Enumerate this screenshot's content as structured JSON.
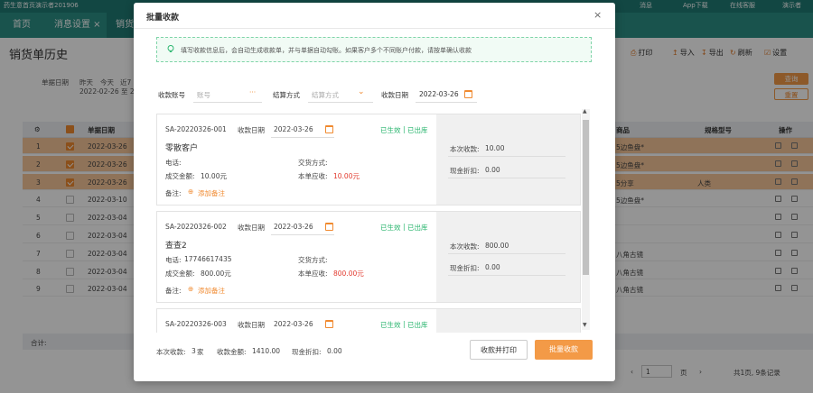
{
  "app": {
    "header_left": "药生意首页演示者201906",
    "header_right": [
      "消息",
      "App下载",
      "在线客服",
      "演示者"
    ]
  },
  "tabs": [
    {
      "label": "首页",
      "active": false
    },
    {
      "label": "消息设置 ×",
      "active": false
    },
    {
      "label": "销货",
      "active": true
    }
  ],
  "page": {
    "title": "销货单历史",
    "tools": [
      "打印",
      "导入",
      "导出",
      "刷新",
      "设置"
    ],
    "filter": {
      "label": "单据日期",
      "quick": [
        "昨天",
        "今天",
        "近7"
      ],
      "range": "2022-02-26 至 2"
    },
    "query_btn": "查询",
    "reset_btn": "重置"
  },
  "table": {
    "headers": {
      "date": "单据日期",
      "product": "商品",
      "spec": "规格型号",
      "ops": "操作"
    },
    "rows": [
      {
        "no": "1",
        "date": "2022-03-26",
        "checked": true,
        "product": "5边鱼盘*",
        "spec": ""
      },
      {
        "no": "2",
        "date": "2022-03-26",
        "checked": true,
        "product": "5边鱼盘*",
        "spec": ""
      },
      {
        "no": "3",
        "date": "2022-03-26",
        "checked": true,
        "product": "5分享",
        "spec": "人类"
      },
      {
        "no": "4",
        "date": "2022-03-10",
        "checked": false,
        "product": "5边鱼盘*",
        "spec": ""
      },
      {
        "no": "5",
        "date": "2022-03-04",
        "checked": false,
        "product": "",
        "spec": ""
      },
      {
        "no": "6",
        "date": "2022-03-04",
        "checked": false,
        "product": "",
        "spec": ""
      },
      {
        "no": "7",
        "date": "2022-03-04",
        "checked": false,
        "product": "八角古镜",
        "spec": ""
      },
      {
        "no": "8",
        "date": "2022-03-04",
        "checked": false,
        "product": "八角古镜",
        "spec": ""
      },
      {
        "no": "9",
        "date": "2022-03-04",
        "checked": false,
        "product": "八角古镜",
        "spec": ""
      }
    ],
    "sum_label": "合计:"
  },
  "pager": {
    "page": "1",
    "page_label": "页",
    "total": "共1页, 9条记录"
  },
  "modal": {
    "title": "批量收款",
    "close": "×",
    "tip": "填写收款信息后，会自动生成收款单，并与单据自动勾账。如果客户多个不同账户付款，请按单确认收款",
    "form": {
      "account_label": "收款账号",
      "account_placeholder": "账号",
      "method_label": "结算方式",
      "method_placeholder": "结算方式",
      "date_label": "收款日期",
      "date_value": "2022-03-26"
    },
    "cards": [
      {
        "no": "SA-20220326-001",
        "date_label": "收款日期",
        "date": "2022-03-26",
        "status1": "已生效",
        "status2": "已出库",
        "customer": "零散客户",
        "phone_label": "电话:",
        "phone": "",
        "delivery_label": "交货方式:",
        "delivery": "",
        "amount_label": "成交金额:",
        "amount": "10.00元",
        "receivable_label": "本单应收:",
        "receivable": "10.00元",
        "remark_label": "备注:",
        "add_remark": "添加备注",
        "this_label": "本次收款:",
        "this_value": "10.00",
        "discount_label": "现金折扣:",
        "discount_value": "0.00"
      },
      {
        "no": "SA-20220326-002",
        "date_label": "收款日期",
        "date": "2022-03-26",
        "status1": "已生效",
        "status2": "已出库",
        "customer": "查查2",
        "phone_label": "电话:",
        "phone": "17746617435",
        "delivery_label": "交货方式:",
        "delivery": "",
        "amount_label": "成交金额:",
        "amount": "800.00元",
        "receivable_label": "本单应收:",
        "receivable": "800.00元",
        "remark_label": "备注:",
        "add_remark": "添加备注",
        "this_label": "本次收款:",
        "this_value": "800.00",
        "discount_label": "现金折扣:",
        "discount_value": "0.00"
      },
      {
        "no": "SA-20220326-003",
        "date_label": "收款日期",
        "date": "2022-03-26",
        "status1": "已生效",
        "status2": "已出库"
      }
    ],
    "footer": {
      "count_label": "本次收款:",
      "count_value": "3",
      "count_unit": "家",
      "amount_label": "收款金额:",
      "amount_value": "1410.00",
      "discount_label": "现金折扣:",
      "discount_value": "0.00",
      "print_btn": "收款并打印",
      "submit_btn": "批量收款"
    }
  },
  "colors": {
    "accent": "#f08a30",
    "green": "#23b36a",
    "red": "#e23a2e",
    "header": "#1f7a74"
  }
}
